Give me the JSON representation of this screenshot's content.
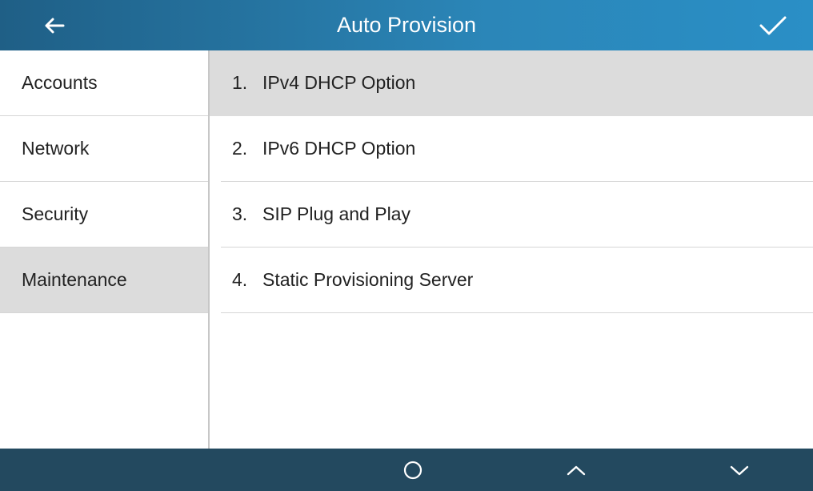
{
  "header": {
    "title": "Auto Provision",
    "back_icon": "arrow-left-icon",
    "confirm_icon": "check-icon"
  },
  "sidebar": {
    "items": [
      {
        "label": "Accounts"
      },
      {
        "label": "Network"
      },
      {
        "label": "Security"
      },
      {
        "label": "Maintenance",
        "active": true
      }
    ]
  },
  "main": {
    "items": [
      {
        "number": "1.",
        "label": "IPv4 DHCP Option",
        "selected": true
      },
      {
        "number": "2.",
        "label": "IPv6 DHCP Option"
      },
      {
        "number": "3.",
        "label": "SIP Plug and Play"
      },
      {
        "number": "4.",
        "label": "Static Provisioning Server"
      }
    ]
  },
  "footer": {
    "buttons": [
      "circle-icon",
      "chevron-up-icon",
      "chevron-down-icon"
    ]
  },
  "colors": {
    "header": "#2b86b8",
    "footer": "#23495f",
    "selected_bg": "#dcdcdc"
  }
}
